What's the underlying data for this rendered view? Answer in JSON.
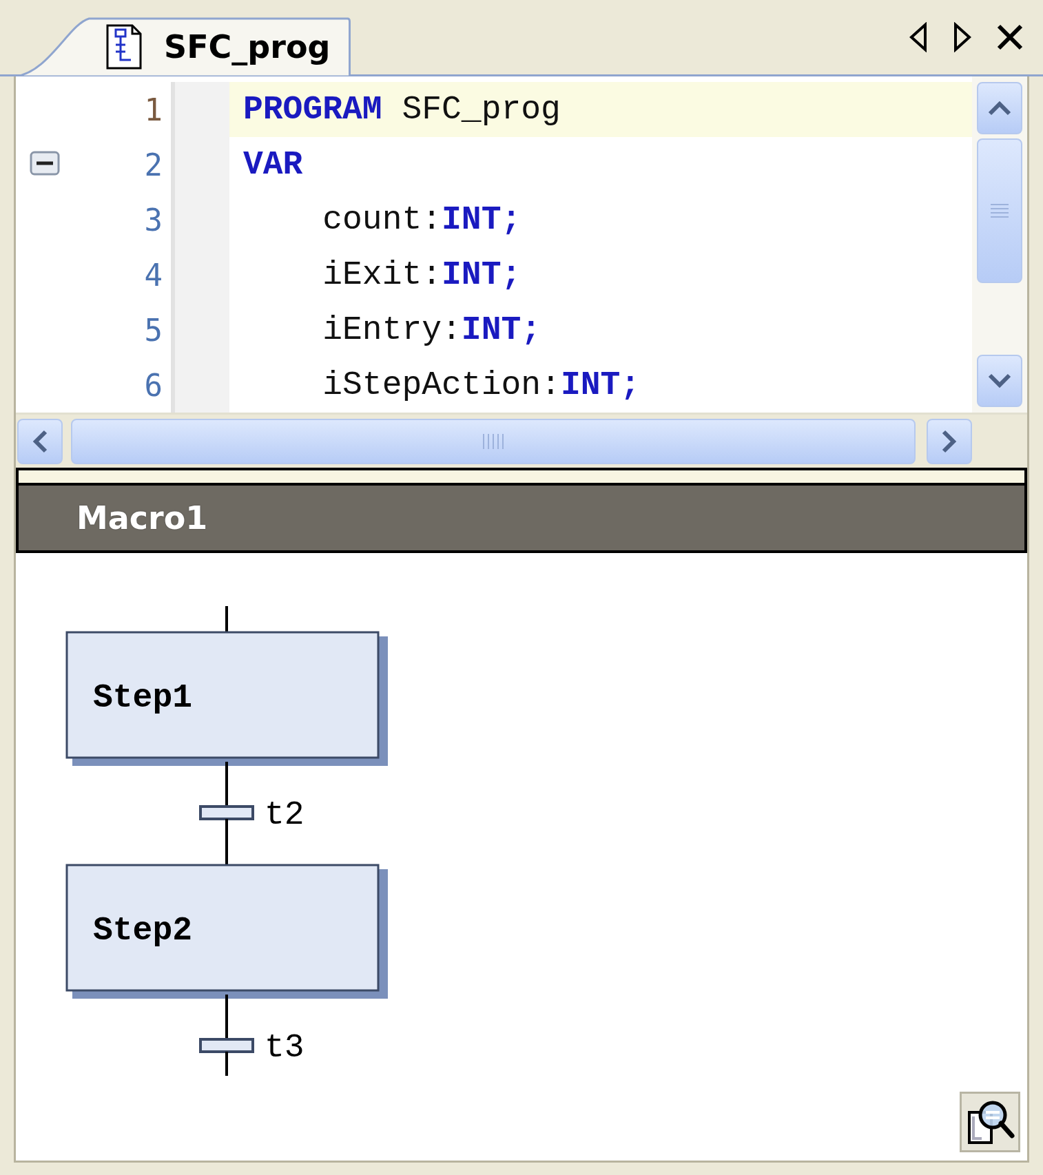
{
  "tabs": [
    {
      "label": "SFC_prog",
      "selected": true
    }
  ],
  "editor": {
    "lines": [
      {
        "number": "1",
        "current": true,
        "collapse_button": false,
        "segments": [
          {
            "kind": "keyword",
            "text": "PROGRAM"
          },
          {
            "kind": "plain",
            "text": " SFC_prog"
          }
        ]
      },
      {
        "number": "2",
        "current": false,
        "collapse_button": true,
        "segments": [
          {
            "kind": "keyword",
            "text": "VAR"
          }
        ]
      },
      {
        "number": "3",
        "current": false,
        "collapse_button": false,
        "segments": [
          {
            "kind": "plain",
            "text": "    count:"
          },
          {
            "kind": "keyword",
            "text": "INT;"
          }
        ]
      },
      {
        "number": "4",
        "current": false,
        "collapse_button": false,
        "segments": [
          {
            "kind": "plain",
            "text": "    iExit:"
          },
          {
            "kind": "keyword",
            "text": "INT;"
          }
        ]
      },
      {
        "number": "5",
        "current": false,
        "collapse_button": false,
        "segments": [
          {
            "kind": "plain",
            "text": "    iEntry:"
          },
          {
            "kind": "keyword",
            "text": "INT;"
          }
        ]
      },
      {
        "number": "6",
        "current": false,
        "collapse_button": false,
        "segments": [
          {
            "kind": "plain",
            "text": "    iStepAction:"
          },
          {
            "kind": "keyword",
            "text": "INT;"
          }
        ]
      }
    ]
  },
  "sfc": {
    "title": "Macro1",
    "elements": [
      {
        "kind": "step",
        "label": "Step1"
      },
      {
        "kind": "transition",
        "label": "t2"
      },
      {
        "kind": "step",
        "label": "Step2"
      },
      {
        "kind": "transition",
        "label": "t3"
      }
    ]
  }
}
